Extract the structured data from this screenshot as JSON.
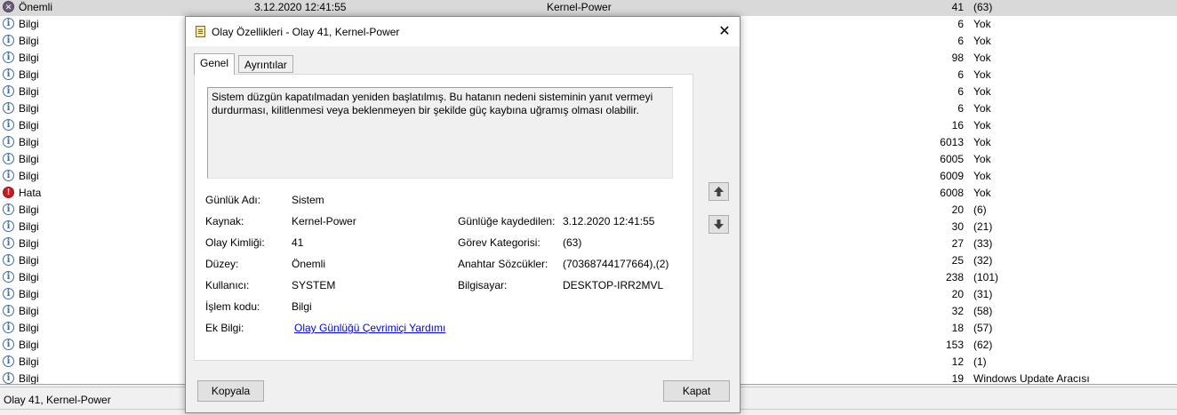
{
  "event_list": {
    "rows": [
      {
        "level": "Önemli",
        "type": "crit",
        "date": "3.12.2020 12:41:55",
        "source": "Kernel-Power",
        "id": "41",
        "category": "(63)"
      },
      {
        "level": "Bilgi",
        "type": "info",
        "date": "",
        "source": "",
        "id": "6",
        "category": "Yok"
      },
      {
        "level": "Bilgi",
        "type": "info",
        "date": "",
        "source": "",
        "id": "6",
        "category": "Yok"
      },
      {
        "level": "Bilgi",
        "type": "info",
        "date": "",
        "source": "",
        "id": "98",
        "category": "Yok"
      },
      {
        "level": "Bilgi",
        "type": "info",
        "date": "",
        "source": "",
        "id": "6",
        "category": "Yok"
      },
      {
        "level": "Bilgi",
        "type": "info",
        "date": "",
        "source": "",
        "id": "6",
        "category": "Yok"
      },
      {
        "level": "Bilgi",
        "type": "info",
        "date": "",
        "source": "",
        "id": "6",
        "category": "Yok"
      },
      {
        "level": "Bilgi",
        "type": "info",
        "date": "",
        "source": "",
        "id": "16",
        "category": "Yok"
      },
      {
        "level": "Bilgi",
        "type": "info",
        "date": "",
        "source": "",
        "id": "6013",
        "category": "Yok"
      },
      {
        "level": "Bilgi",
        "type": "info",
        "date": "",
        "source": "",
        "id": "6005",
        "category": "Yok"
      },
      {
        "level": "Bilgi",
        "type": "info",
        "date": "",
        "source": "",
        "id": "6009",
        "category": "Yok"
      },
      {
        "level": "Hata",
        "type": "err",
        "date": "",
        "source": "",
        "id": "6008",
        "category": "Yok"
      },
      {
        "level": "Bilgi",
        "type": "info",
        "date": "",
        "source": "",
        "id": "20",
        "category": "(6)"
      },
      {
        "level": "Bilgi",
        "type": "info",
        "date": "",
        "source": "",
        "id": "30",
        "category": "(21)"
      },
      {
        "level": "Bilgi",
        "type": "info",
        "date": "",
        "source": "",
        "id": "27",
        "category": "(33)"
      },
      {
        "level": "Bilgi",
        "type": "info",
        "date": "",
        "source": "",
        "id": "25",
        "category": "(32)"
      },
      {
        "level": "Bilgi",
        "type": "info",
        "date": "",
        "source": "",
        "id": "238",
        "category": "(101)"
      },
      {
        "level": "Bilgi",
        "type": "info",
        "date": "",
        "source": "",
        "id": "20",
        "category": "(31)"
      },
      {
        "level": "Bilgi",
        "type": "info",
        "date": "",
        "source": "",
        "id": "32",
        "category": "(58)"
      },
      {
        "level": "Bilgi",
        "type": "info",
        "date": "",
        "source": "",
        "id": "18",
        "category": "(57)"
      },
      {
        "level": "Bilgi",
        "type": "info",
        "date": "",
        "source": "",
        "id": "153",
        "category": "(62)"
      },
      {
        "level": "Bilgi",
        "type": "info",
        "date": "",
        "source": "",
        "id": "12",
        "category": "(1)"
      },
      {
        "level": "Bilgi",
        "type": "info",
        "date": "",
        "source": "",
        "id": "19",
        "category": "Windows Update Aracısı"
      }
    ]
  },
  "status_bar": {
    "text": "Olay 41, Kernel-Power"
  },
  "dialog": {
    "title": "Olay Özellikleri - Olay 41, Kernel-Power",
    "tabs": {
      "general": "Genel",
      "details": "Ayrıntılar"
    },
    "description": "Sistem düzgün kapatılmadan yeniden başlatılmış. Bu hatanın nedeni sisteminin yanıt vermeyi durdurması, kilitlenmesi veya beklenmeyen bir şekilde güç kaybına uğramış olması olabilir.",
    "props": {
      "log_name_label": "Günlük Adı:",
      "log_name": "Sistem",
      "source_label": "Kaynak:",
      "source": "Kernel-Power",
      "logged_label": "Günlüğe kaydedilen:",
      "logged": "3.12.2020 12:41:55",
      "event_id_label": "Olay Kimliği:",
      "event_id": "41",
      "task_category_label": "Görev Kategorisi:",
      "task_category": "(63)",
      "level_label": "Düzey:",
      "level": "Önemli",
      "keywords_label": "Anahtar Sözcükler:",
      "keywords": "(70368744177664),(2)",
      "user_label": "Kullanıcı:",
      "user": "SYSTEM",
      "computer_label": "Bilgisayar:",
      "computer": "DESKTOP-IRR2MVL",
      "opcode_label": "İşlem kodu:",
      "opcode": "Bilgi",
      "more_info_label": "Ek Bilgi:",
      "more_info_link": "Olay Günlüğü Çevrimiçi Yardımı"
    },
    "buttons": {
      "copy": "Kopyala",
      "close": "Kapat"
    }
  }
}
